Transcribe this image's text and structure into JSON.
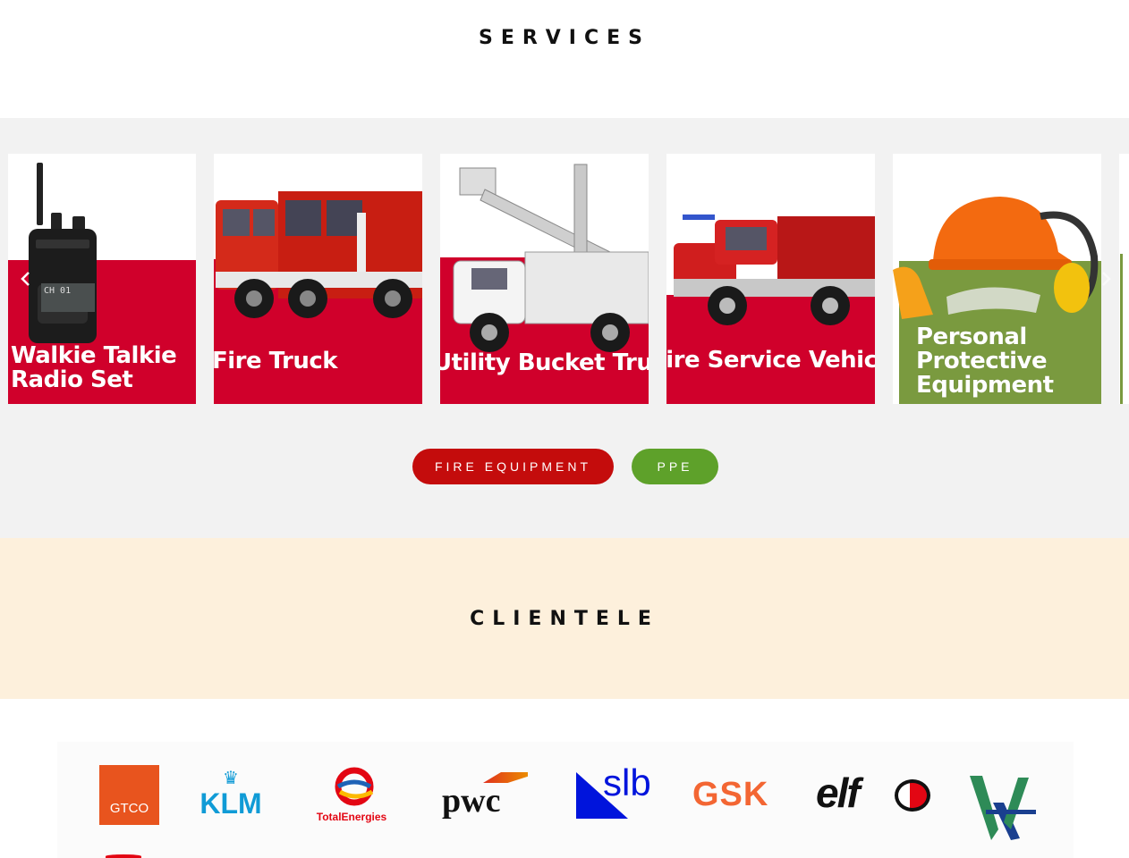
{
  "services": {
    "title": "SERVICES",
    "cards": [
      {
        "line1": "Walkie Talkie",
        "line2": "Radio Set"
      },
      {
        "line1": "Fire Truck"
      },
      {
        "line1": "Utility Bucket Truck"
      },
      {
        "line1": "Fire Service Vehicle"
      },
      {
        "line1": "Personal",
        "line2": "Protective",
        "line3": "Equipment"
      }
    ],
    "radio_display": "CH 01",
    "filters": {
      "fire": "FIRE EQUIPMENT",
      "ppe": "PPE"
    }
  },
  "clientele": {
    "title": "CLIENTELE",
    "logos": {
      "gtco": "GTCO",
      "klm": "KLM",
      "total": "TotalEnergies",
      "pwc": "pwc",
      "slb": "slb",
      "gsk": "GSK",
      "elf": "elf"
    }
  },
  "colors": {
    "accent_red": "#d0002b",
    "filter_red": "#c40c0c",
    "filter_green": "#5ea12a",
    "ppe_card_green": "#7a9a3f",
    "services_bg": "#f2f2f2",
    "clientele_bg": "#fdf0dc"
  },
  "icons": {
    "prev": "chevron-left-icon",
    "next": "chevron-right-icon"
  }
}
